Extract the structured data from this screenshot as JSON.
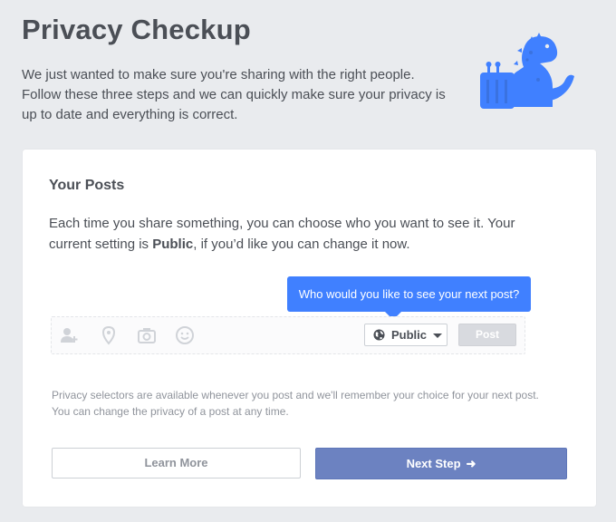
{
  "header": {
    "title": "Privacy Checkup",
    "intro": "We just wanted to make sure you're sharing with the right people. Follow these three steps and we can quickly make sure your privacy is up to date and everything is correct."
  },
  "card": {
    "section_title": "Your Posts",
    "desc_before": "Each time you share something, you can choose who you want to see it. Your current setting is ",
    "desc_setting": "Public",
    "desc_after": ", if you’d like you can change it now.",
    "tooltip": "Who would you like to see your next post?",
    "composer": {
      "icons": [
        "tag-friends-icon",
        "location-pin-icon",
        "camera-icon",
        "smiley-icon"
      ],
      "audience_label": "Public",
      "audience_icon": "globe-icon",
      "post_label": "Post"
    },
    "note": "Privacy selectors are available whenever you post and we'll remember your choice for your next post. You can change the privacy of a post at any time.",
    "learn_more_label": "Learn More",
    "next_step_label": "Next Step",
    "next_step_icon": "arrow-right-icon"
  },
  "colors": {
    "background": "#e9ebee",
    "tooltip": "#4080ff",
    "primary_button": "#6c82c1",
    "mascot": "#4080ff"
  }
}
